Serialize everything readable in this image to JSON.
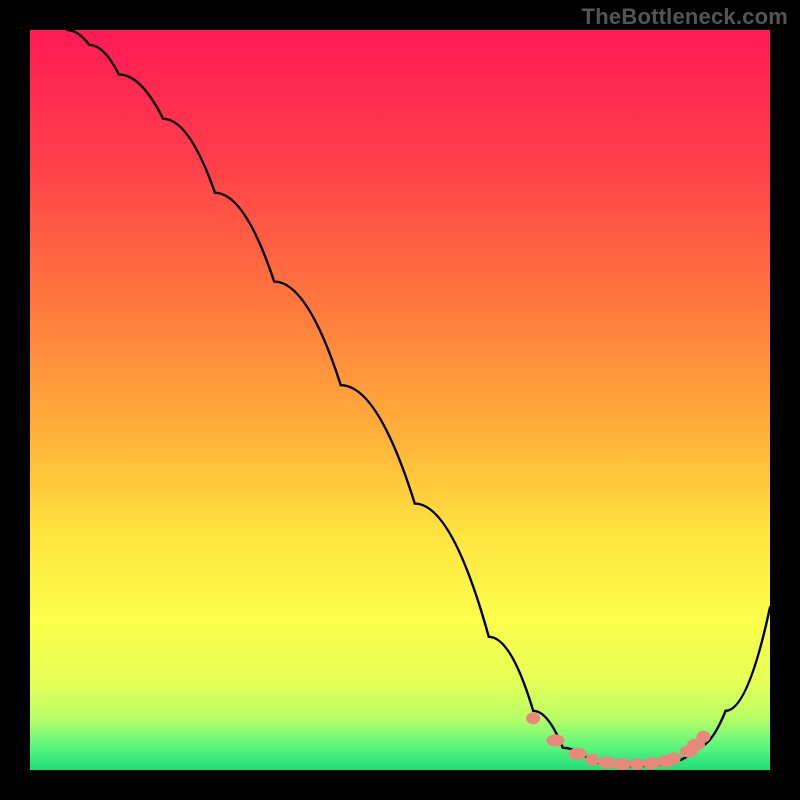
{
  "watermark": "TheBottleneck.com",
  "chart_data": {
    "type": "line",
    "title": "",
    "xlabel": "",
    "ylabel": "",
    "xlim": [
      0,
      100
    ],
    "ylim": [
      0,
      100
    ],
    "series": [
      {
        "name": "bottleneck-curve",
        "x": [
          5,
          8,
          12,
          18,
          25,
          33,
          42,
          52,
          62,
          68,
          72,
          76,
          80,
          84,
          87,
          90,
          94,
          100
        ],
        "y": [
          100,
          98,
          94,
          88,
          78,
          66,
          52,
          36,
          18,
          8,
          3,
          1,
          0.5,
          0.6,
          1.2,
          3,
          8,
          22
        ]
      }
    ],
    "markers": {
      "name": "highlight-points",
      "color": "#e8877a",
      "x": [
        68,
        71,
        74,
        76,
        78,
        80,
        82,
        84,
        86,
        87,
        89,
        90,
        91
      ],
      "y": [
        7,
        4,
        2.2,
        1.4,
        1.0,
        0.8,
        0.8,
        0.9,
        1.2,
        1.6,
        2.5,
        3.4,
        4.5
      ]
    },
    "gradient_stops": [
      {
        "offset": 0,
        "color": "#ff1a56"
      },
      {
        "offset": 18,
        "color": "#ff3f4a"
      },
      {
        "offset": 38,
        "color": "#ff7b3d"
      },
      {
        "offset": 55,
        "color": "#ffb23a"
      },
      {
        "offset": 68,
        "color": "#ffe43f"
      },
      {
        "offset": 80,
        "color": "#fbff4a"
      },
      {
        "offset": 88,
        "color": "#e6ff57"
      },
      {
        "offset": 93,
        "color": "#b8ff66"
      },
      {
        "offset": 97,
        "color": "#57f57e"
      },
      {
        "offset": 100,
        "color": "#1fdc78"
      }
    ]
  }
}
